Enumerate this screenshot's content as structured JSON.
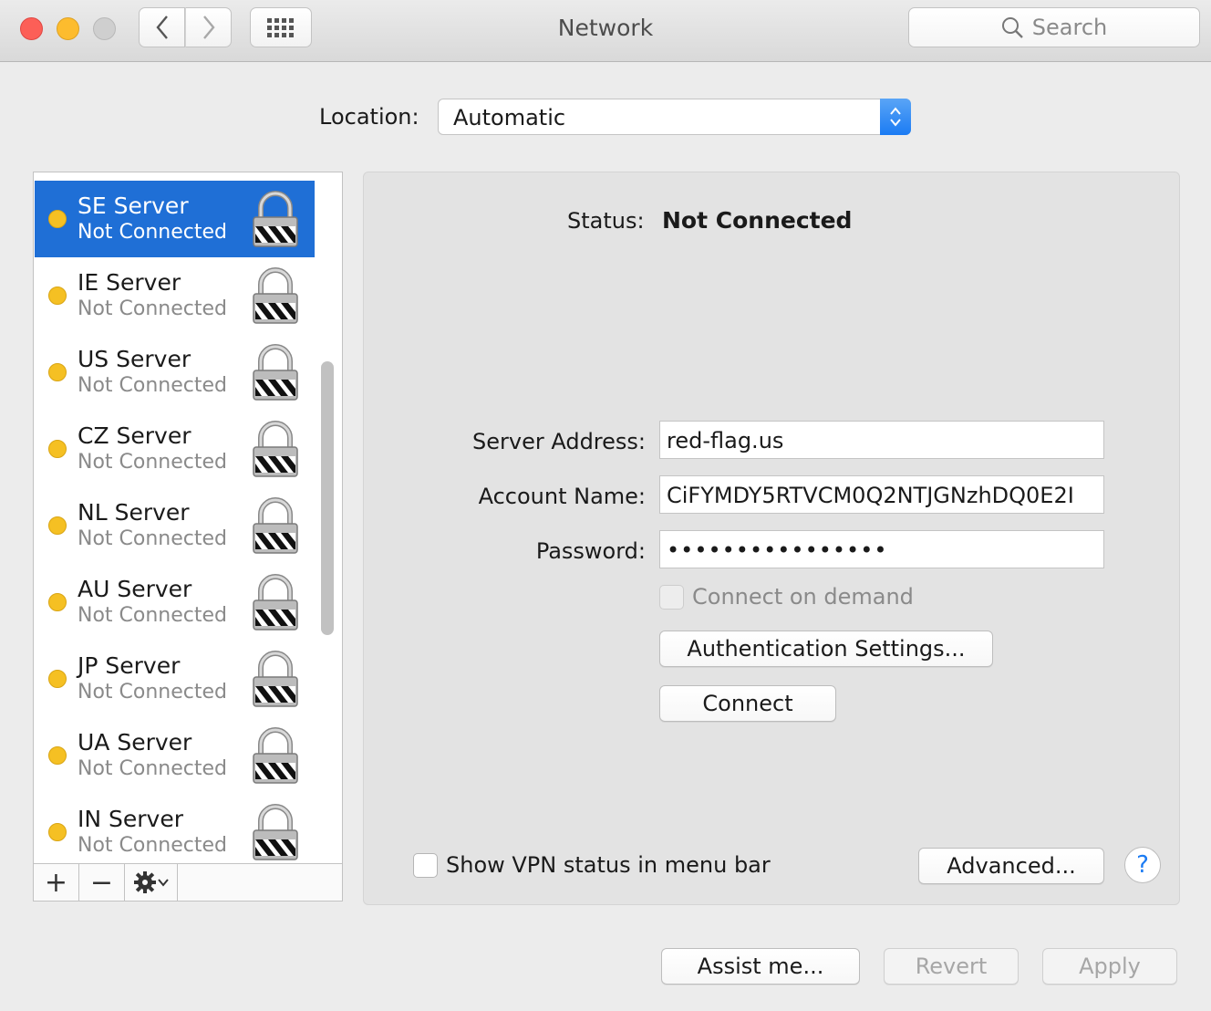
{
  "window": {
    "title": "Network",
    "search_placeholder": "Search"
  },
  "location": {
    "label": "Location:",
    "value": "Automatic"
  },
  "services": [
    {
      "name": "SE Server",
      "status": "Not Connected",
      "selected": true
    },
    {
      "name": "IE Server",
      "status": "Not Connected"
    },
    {
      "name": "US Server",
      "status": "Not Connected"
    },
    {
      "name": "CZ Server",
      "status": "Not Connected"
    },
    {
      "name": "NL Server",
      "status": "Not Connected"
    },
    {
      "name": "AU Server",
      "status": "Not Connected"
    },
    {
      "name": "JP Server",
      "status": "Not Connected"
    },
    {
      "name": "UA Server",
      "status": "Not Connected"
    },
    {
      "name": "IN Server",
      "status": "Not Connected"
    }
  ],
  "sidebar_tools": {
    "add": "+",
    "remove": "−"
  },
  "detail": {
    "status_label": "Status:",
    "status_value": "Not Connected",
    "server_address_label": "Server Address:",
    "server_address_value": "red-flag.us",
    "account_name_label": "Account Name:",
    "account_name_value": "CiFYMDY5RTVCM0Q2NTJGNzhDQ0E2I",
    "password_label": "Password:",
    "password_value": "••••••••••••••••",
    "connect_on_demand_label": "Connect on demand",
    "auth_settings_label": "Authentication Settings...",
    "connect_label": "Connect",
    "show_vpn_status_label": "Show VPN status in menu bar",
    "advanced_label": "Advanced...",
    "help_label": "?"
  },
  "footer": {
    "assist_label": "Assist me...",
    "revert_label": "Revert",
    "apply_label": "Apply"
  },
  "colors": {
    "selection": "#1f6fd6",
    "status_dot": "#f5c023",
    "accent": "#1b7bf3"
  }
}
